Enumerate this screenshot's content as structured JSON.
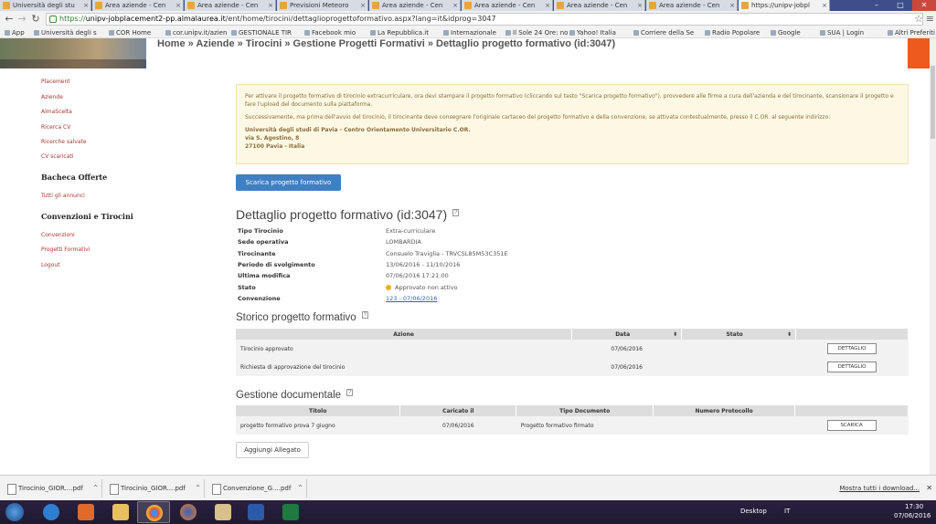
{
  "browser": {
    "tabs": [
      {
        "label": "Università degli stu"
      },
      {
        "label": "Area aziende - Cen"
      },
      {
        "label": "Area aziende - Cen"
      },
      {
        "label": "Previsioni Meteoro"
      },
      {
        "label": "Area aziende - Cen"
      },
      {
        "label": "Area aziende - Cen"
      },
      {
        "label": "Area aziende - Cen"
      },
      {
        "label": "Area aziende - Cen"
      },
      {
        "label": "https://unipv-jobpl"
      }
    ],
    "url_scheme": "https://",
    "url_host": "unipv-jobplacement2-pp.almalaurea.it",
    "url_path": "/ent/home/tirocini/dettaglioprogettoformativo.aspx?lang=it&idprog=3047",
    "bookmarks": [
      "App",
      "Università degli s",
      "COR Home",
      "cor.unipv.it/azien",
      "GESTIONALE TIR",
      "Facebook mio",
      "La Repubblica.it",
      "Internazionale",
      "Il Sole 24 Ore: no",
      "Yahoo! Italia",
      "Corriere della Se",
      "Radio Popolare",
      "Google",
      "SUA | Login"
    ],
    "bookmarks_other": "Altri Preferiti"
  },
  "breadcrumb": "Home » Aziende » Tirocini » Gestione Progetti Formativi » Dettaglio progetto formativo (id:3047)",
  "nav": {
    "links1": [
      "Placement",
      "Aziende",
      "AlmaScelta",
      "Ricerca CV",
      "Ricerche salvate",
      "CV scaricati"
    ],
    "heading1": "Bacheca Offerte",
    "links2": [
      "Tutti gli annunci"
    ],
    "heading2": "Convenzioni e Tirocini",
    "links3": [
      "Convenzioni",
      "Progetti Formativi",
      "Logout"
    ]
  },
  "info": {
    "p1": "Per attivare il progetto formativo di tirocinio extracurriculare, ora devi stampare il progetto formativo (cliccando sul tasto \"Scarica progetto formativo\"), provvedere alle firme a cura dell'azienda e del tirocinante, scansionare il progetto e fare l'upload del documento sulla piattaforma.",
    "p2": "Successivamente, ma prima dell'avvio del tirocinio, il tirocinante deve consegnare l'originale cartaceo del progetto formativo e della convenzione, se attivata contestualmente, presso il C.OR. al seguente indirizzo:",
    "addr1": "Università degli studi di Pavia - Centro Orientamento Universitario C.OR.",
    "addr2": "via S. Agostino, 8",
    "addr3": "27100 Pavia - Italia"
  },
  "download_button": "Scarica progetto formativo",
  "detail": {
    "title": "Dettaglio progetto formativo (id:3047)",
    "help": "?",
    "rows": [
      {
        "k": "Tipo Tirocinio",
        "v": "Extra-curriculare"
      },
      {
        "k": "Sede operativa",
        "v": "LOMBARDIA"
      },
      {
        "k": "Tirocinante",
        "v": "Consuelo Traviglia - TRVCSL85M53C351E"
      },
      {
        "k": "Periodo di svolgimento",
        "v": "13/06/2016 - 11/10/2016"
      },
      {
        "k": "Ultima modifica",
        "v": "07/06/2016 17:21:00"
      },
      {
        "k": "Stato",
        "v": "Approvato non attivo"
      },
      {
        "k": "Convenzione",
        "v": "123 - 07/06/2016"
      }
    ]
  },
  "storico": {
    "title": "Storico progetto formativo",
    "help": "?",
    "headers": [
      "Azione",
      "Data",
      "Stato",
      ""
    ],
    "rows": [
      {
        "azione": "Tirocinio approvato",
        "data": "07/06/2016",
        "stato": "",
        "btn": "DETTAGLIO"
      },
      {
        "azione": "Richiesta di approvazione del tirocinio",
        "data": "07/06/2016",
        "stato": "",
        "btn": "DETTAGLIO"
      }
    ]
  },
  "documentale": {
    "title": "Gestione documentale",
    "help": "?",
    "headers": [
      "Titolo",
      "Caricato il",
      "Tipo Documento",
      "Numero Protocollo",
      ""
    ],
    "rows": [
      {
        "titolo": "progetto formativo prova 7 giugno",
        "caricato": "07/06/2016",
        "tipo": "Progetto formativo firmato",
        "protocollo": "",
        "btn": "SCARICA"
      }
    ],
    "add_button": "Aggiungi Allegato"
  },
  "downloads": {
    "items": [
      "Tirocinio_GIOR....pdf",
      "Tirocinio_GIOR....pdf",
      "Convenzione_G....pdf"
    ],
    "show_all": "Mostra tutti i download..."
  },
  "taskbar": {
    "desktop": "Desktop",
    "lang": "IT",
    "time": "17:30",
    "date": "07/06/2016"
  }
}
